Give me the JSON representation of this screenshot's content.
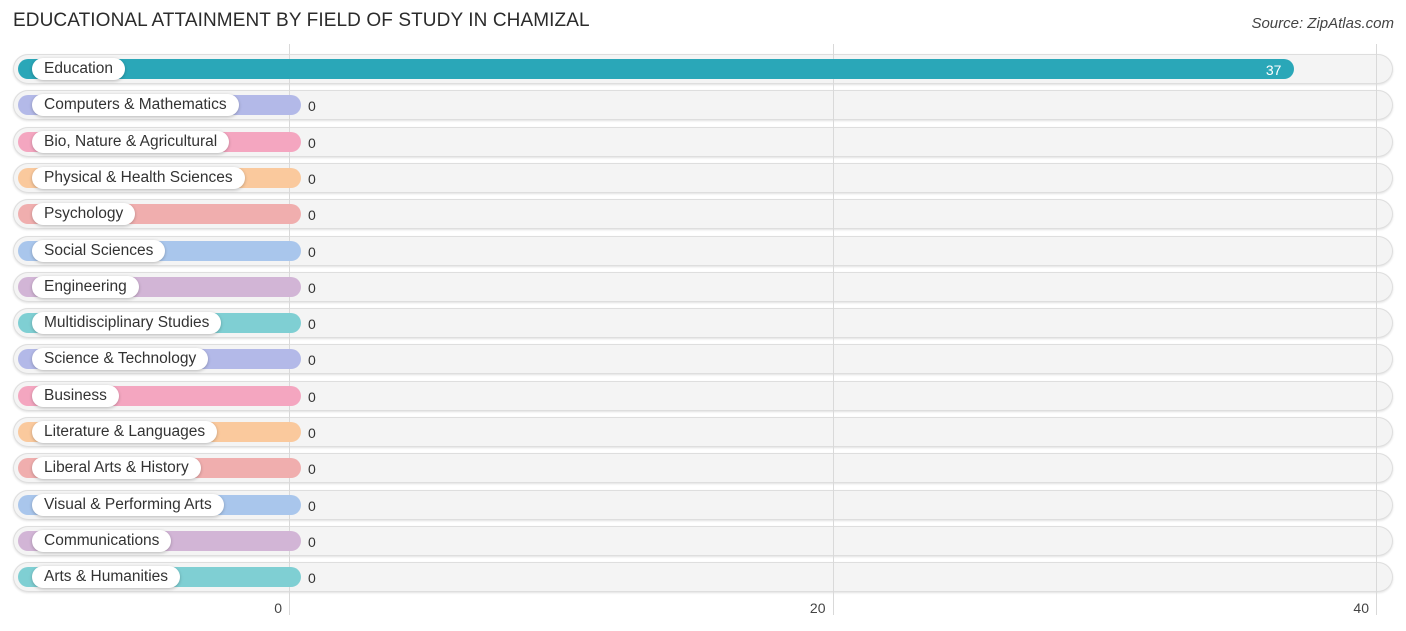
{
  "header": {
    "title": "EDUCATIONAL ATTAINMENT BY FIELD OF STUDY IN CHAMIZAL",
    "source": "Source: ZipAtlas.com"
  },
  "chart_data": {
    "type": "bar",
    "orientation": "horizontal",
    "title": "EDUCATIONAL ATTAINMENT BY FIELD OF STUDY IN CHAMIZAL",
    "xlabel": "",
    "ylabel": "",
    "xlim": [
      0,
      40
    ],
    "x_ticks": [
      0,
      20,
      40
    ],
    "x_tick_labels": [
      "0",
      "20",
      "40"
    ],
    "grid": true,
    "categories": [
      "Education",
      "Computers & Mathematics",
      "Bio, Nature & Agricultural",
      "Physical & Health Sciences",
      "Psychology",
      "Social Sciences",
      "Engineering",
      "Multidisciplinary Studies",
      "Science & Technology",
      "Business",
      "Literature & Languages",
      "Liberal Arts & History",
      "Visual & Performing Arts",
      "Communications",
      "Arts & Humanities"
    ],
    "values": [
      37,
      0,
      0,
      0,
      0,
      0,
      0,
      0,
      0,
      0,
      0,
      0,
      0,
      0,
      0
    ],
    "value_labels": [
      "37",
      "0",
      "0",
      "0",
      "0",
      "0",
      "0",
      "0",
      "0",
      "0",
      "0",
      "0",
      "0",
      "0",
      "0"
    ],
    "colors": [
      "#2aa7b8",
      "#b3b9e8",
      "#f4a6c0",
      "#fac99d",
      "#f0aeae",
      "#a9c6ec",
      "#d2b5d6",
      "#7fcfd3",
      "#b3b9e8",
      "#f4a6c0",
      "#fac99d",
      "#f0aeae",
      "#a9c6ec",
      "#d2b5d6",
      "#7fcfd3"
    ]
  }
}
